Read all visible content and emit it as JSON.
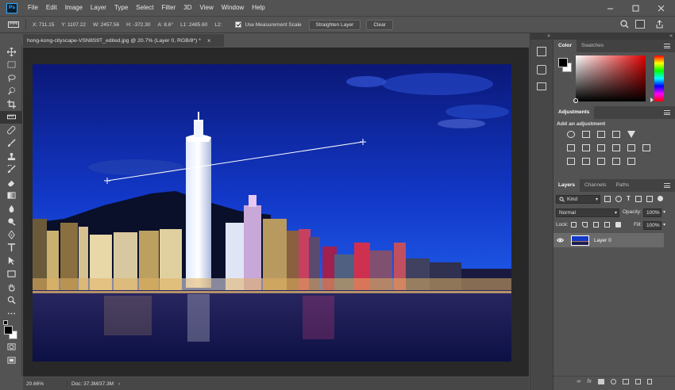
{
  "app": {
    "logo": "Ps"
  },
  "menu": [
    "File",
    "Edit",
    "Image",
    "Layer",
    "Type",
    "Select",
    "Filter",
    "3D",
    "View",
    "Window",
    "Help"
  ],
  "options": {
    "x": "X: 711.15",
    "y": "Y: 1107.22",
    "w": "W: 2457.56",
    "h": "H: -372.30",
    "a": "A: 8.6°",
    "l1": "L1: 2485.60",
    "l2": "L2:",
    "use_measurement_scale": "Use Measurement Scale",
    "straighten": "Straighten Layer",
    "clear": "Clear"
  },
  "document": {
    "tab_title": "hong-kong-cityscape-VSN8S9T_edited.jpg @ 20.7% (Layer 0, RGB/8*) *",
    "zoom": "20.66%",
    "doc_size": "Doc: 37.3M/37.3M"
  },
  "color_panel": {
    "tabs": [
      "Color",
      "Swatches"
    ]
  },
  "adjustments_panel": {
    "title": "Adjustments",
    "subtitle": "Add an adjustment"
  },
  "layers_panel": {
    "tabs": [
      "Layers",
      "Channels",
      "Paths"
    ],
    "filter": "Kind",
    "blend_mode": "Normal",
    "opacity_label": "Opacity:",
    "opacity": "100%",
    "lock_label": "Lock:",
    "fill_label": "Fill:",
    "fill": "100%",
    "layers": [
      {
        "name": "Layer 0"
      }
    ]
  }
}
